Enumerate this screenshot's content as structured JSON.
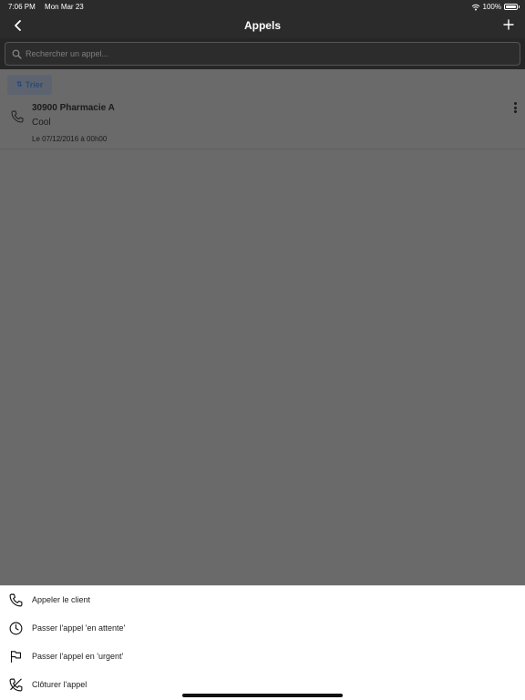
{
  "status_bar": {
    "time": "7:06 PM",
    "date": "Mon Mar 23",
    "battery": "100%",
    "wifi_icon": "wifi-icon",
    "battery_icon": "battery-icon",
    "battery_level": 1.0
  },
  "nav": {
    "title": "Appels",
    "back_icon": "chevron-left-icon",
    "add_icon": "plus-icon"
  },
  "search": {
    "placeholder": "Rechercher un appel..."
  },
  "sort": {
    "label": "Trier",
    "icon": "sort-icon"
  },
  "calls": [
    {
      "title": "30900 Pharmacie A",
      "subtitle": "Cool",
      "date": "Le 07/12/2016 à 00h00",
      "icon": "phone-icon",
      "menu_icon": "more-vertical-icon"
    }
  ],
  "action_sheet": {
    "items": [
      {
        "label": "Appeler le client",
        "icon": "phone-icon"
      },
      {
        "label": "Passer l'appel 'en attente'",
        "icon": "clock-icon"
      },
      {
        "label": "Passer l'appel en 'urgent'",
        "icon": "flag-icon"
      },
      {
        "label": "Clôturer l'appel",
        "icon": "phone-off-icon"
      }
    ]
  },
  "colors": {
    "overlay": "#6a6a6a",
    "header": "#2b2b2b",
    "accent": "#2c4a7a",
    "sheet": "#ffffff"
  }
}
